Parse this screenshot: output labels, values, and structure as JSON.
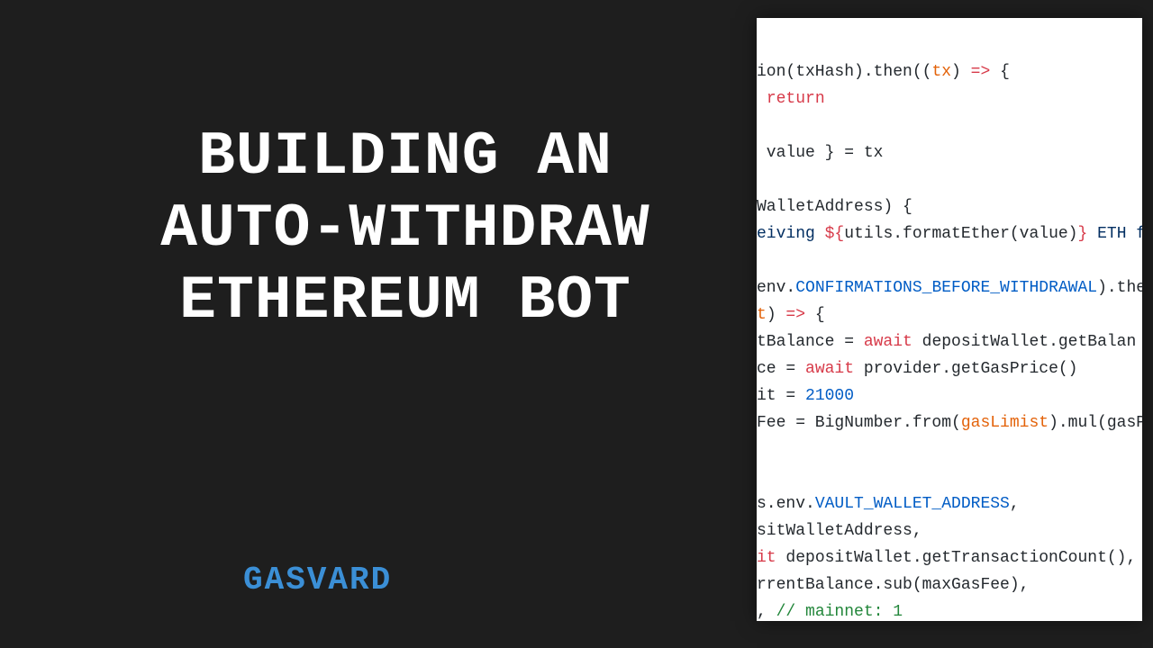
{
  "title_line1": "BUILDING AN",
  "title_line2": "AUTO-WITHDRAW",
  "title_line3": "ETHEREUM BOT",
  "brand": "GASVARD",
  "code": {
    "l1a": "ion(txHash).then((",
    "l1b": "tx",
    "l1c": ") ",
    "l1d": "=>",
    "l1e": " {",
    "l2a": "return",
    "l3": "",
    "l4a": " value } = tx",
    "l5": "",
    "l6a": "WalletAddress) {",
    "l7a": "eiving ",
    "l7b": "${",
    "l7c": "utils.formatEther(value)",
    "l7d": "}",
    "l7e": " ETH f",
    "l8": "",
    "l9a": "env.",
    "l9b": "CONFIRMATIONS_BEFORE_WITHDRAWAL",
    "l9c": ").the",
    "l10a": "t",
    "l10b": ") ",
    "l10c": "=>",
    "l10d": " {",
    "l11a": "tBalance = ",
    "l11b": "await",
    "l11c": " depositWallet.getBalan",
    "l12a": "ce = ",
    "l12b": "await",
    "l12c": " provider.getGasPrice()",
    "l13a": "it = ",
    "l13b": "21000",
    "l14a": "Fee = BigNumber.from(",
    "l14b": "gasLimist",
    "l14c": ").mul(gasP",
    "l15": "",
    "l16": "",
    "l17a": "s.env.",
    "l17b": "VAULT_WALLET_ADDRESS",
    "l17c": ",",
    "l18a": "sitWalletAddress,",
    "l19a": "it",
    "l19b": " depositWallet.getTransactionCount(),",
    "l20a": "rrentBalance.sub(maxGasFee),",
    "l21a": ", ",
    "l21b": "// mainnet: 1"
  }
}
